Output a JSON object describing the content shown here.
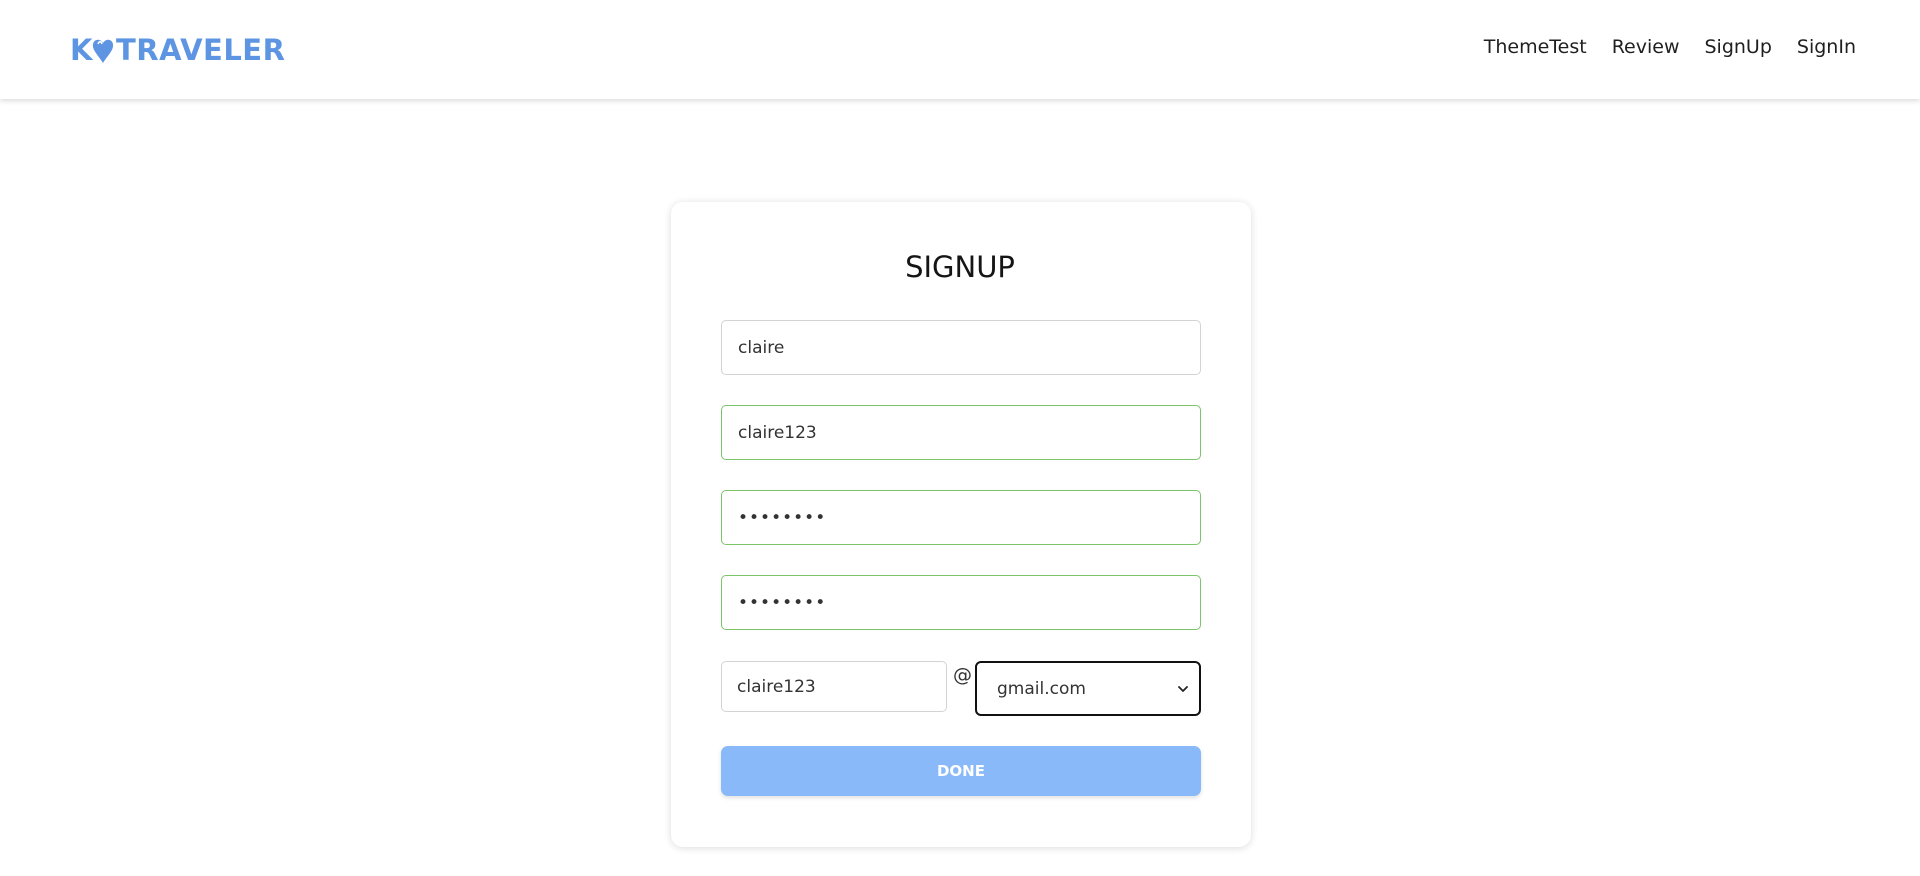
{
  "header": {
    "logo": "TRAVELER",
    "logo_prefix": "K",
    "nav": [
      "ThemeTest",
      "Review",
      "SignUp",
      "SignIn"
    ]
  },
  "signup": {
    "title": "SIGNUP",
    "name_value": "claire",
    "username_value": "claire123",
    "password_value": "••••••••",
    "password_confirm_value": "••••••••",
    "email_local_value": "claire123",
    "at_sign": "@",
    "email_domain_value": "gmail.com",
    "done_label": "DONE"
  },
  "colors": {
    "brand": "#5d95e3",
    "valid_border": "#7cc46a",
    "done_button": "#89b9f8"
  }
}
